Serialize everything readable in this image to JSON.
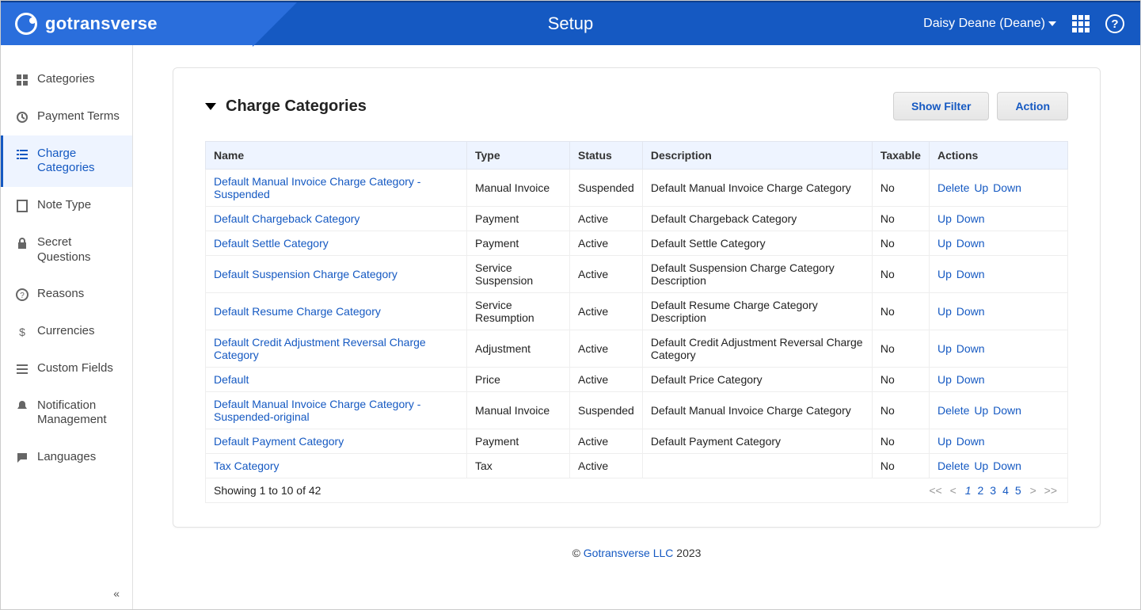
{
  "header": {
    "brand": "gotransverse",
    "title": "Setup",
    "user_label": "Daisy Deane (Deane)",
    "help_glyph": "?"
  },
  "sidebar": {
    "items": [
      {
        "label": "Categories",
        "icon": "categories-icon",
        "active": false
      },
      {
        "label": "Payment Terms",
        "icon": "clock-icon",
        "active": false
      },
      {
        "label": "Charge Categories",
        "icon": "list-icon",
        "active": true
      },
      {
        "label": "Note Type",
        "icon": "note-icon",
        "active": false
      },
      {
        "label": "Secret Questions",
        "icon": "lock-icon",
        "active": false
      },
      {
        "label": "Reasons",
        "icon": "question-icon",
        "active": false
      },
      {
        "label": "Currencies",
        "icon": "dollar-icon",
        "active": false
      },
      {
        "label": "Custom Fields",
        "icon": "lines-icon",
        "active": false
      },
      {
        "label": "Notification Management",
        "icon": "bell-icon",
        "active": false
      },
      {
        "label": "Languages",
        "icon": "speech-icon",
        "active": false
      }
    ],
    "collapse_glyph": "«"
  },
  "panel": {
    "title": "Charge Categories",
    "buttons": {
      "show_filter": "Show Filter",
      "action": "Action"
    },
    "columns": [
      "Name",
      "Type",
      "Status",
      "Description",
      "Taxable",
      "Actions"
    ],
    "rows": [
      {
        "name": "Default Manual Invoice Charge Category - Suspended",
        "type": "Manual Invoice",
        "status": "Suspended",
        "description": "Default Manual Invoice Charge Category",
        "taxable": "No",
        "actions": [
          "Delete",
          "Up",
          "Down"
        ]
      },
      {
        "name": "Default Chargeback Category",
        "type": "Payment",
        "status": "Active",
        "description": "Default Chargeback Category",
        "taxable": "No",
        "actions": [
          "Up",
          "Down"
        ]
      },
      {
        "name": "Default Settle Category",
        "type": "Payment",
        "status": "Active",
        "description": "Default Settle Category",
        "taxable": "No",
        "actions": [
          "Up",
          "Down"
        ]
      },
      {
        "name": "Default Suspension Charge Category",
        "type": "Service Suspension",
        "status": "Active",
        "description": "Default Suspension Charge Category Description",
        "taxable": "No",
        "actions": [
          "Up",
          "Down"
        ]
      },
      {
        "name": "Default Resume Charge Category",
        "type": "Service Resumption",
        "status": "Active",
        "description": "Default Resume Charge Category Description",
        "taxable": "No",
        "actions": [
          "Up",
          "Down"
        ]
      },
      {
        "name": "Default Credit Adjustment Reversal Charge Category",
        "type": "Adjustment",
        "status": "Active",
        "description": "Default Credit Adjustment Reversal Charge Category",
        "taxable": "No",
        "actions": [
          "Up",
          "Down"
        ]
      },
      {
        "name": "Default",
        "type": "Price",
        "status": "Active",
        "description": "Default Price Category",
        "taxable": "No",
        "actions": [
          "Up",
          "Down"
        ]
      },
      {
        "name": "Default Manual Invoice Charge Category - Suspended-original",
        "type": "Manual Invoice",
        "status": "Suspended",
        "description": "Default Manual Invoice Charge Category",
        "taxable": "No",
        "actions": [
          "Delete",
          "Up",
          "Down"
        ]
      },
      {
        "name": "Default Payment Category",
        "type": "Payment",
        "status": "Active",
        "description": "Default Payment Category",
        "taxable": "No",
        "actions": [
          "Up",
          "Down"
        ]
      },
      {
        "name": "Tax Category",
        "type": "Tax",
        "status": "Active",
        "description": "",
        "taxable": "No",
        "actions": [
          "Delete",
          "Up",
          "Down"
        ]
      }
    ],
    "pagination": {
      "summary": "Showing 1 to 10 of 42",
      "first": "<<",
      "prev": "<",
      "next": ">",
      "last": ">>",
      "pages": [
        "1",
        "2",
        "3",
        "4",
        "5"
      ],
      "current": "1"
    }
  },
  "footer": {
    "copyright": "©",
    "link": "Gotransverse LLC",
    "year": "2023"
  }
}
